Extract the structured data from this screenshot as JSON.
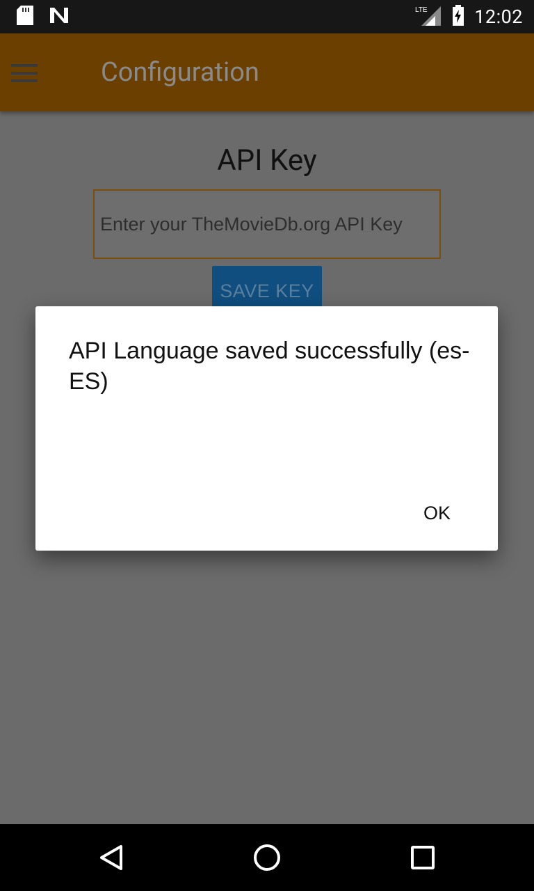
{
  "status_bar": {
    "time": "12:02",
    "network": "LTE",
    "icons": [
      "sd-card-icon",
      "n-logo-icon",
      "lte-signal-icon",
      "battery-charging-icon"
    ]
  },
  "app_bar": {
    "title": "Configuration",
    "menu_icon": "hamburger-menu-icon",
    "background": "#6a3f00"
  },
  "content": {
    "section_title": "API Key",
    "api_key_input": {
      "value": "",
      "placeholder": "Enter your TheMovieDb.org API Key"
    },
    "save_button_label": "SAVE KEY"
  },
  "dialog": {
    "message": "API Language saved successfully (es-ES)",
    "ok_label": "OK"
  },
  "nav_bar": {
    "back_icon": "back-triangle-icon",
    "home_icon": "home-circle-icon",
    "recents_icon": "recents-square-icon"
  }
}
